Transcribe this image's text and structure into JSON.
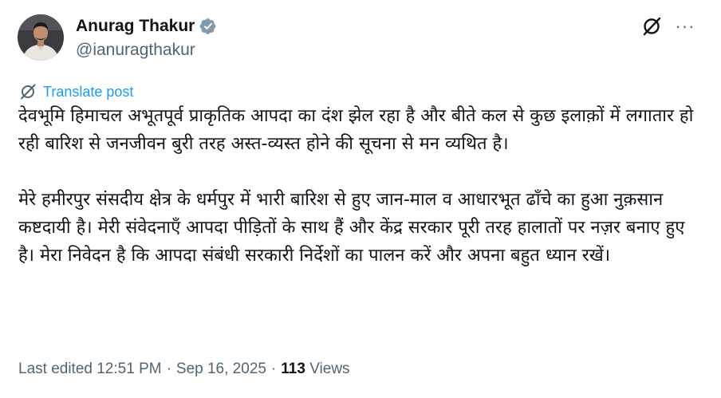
{
  "author": {
    "display_name": "Anurag Thakur",
    "handle": "@ianuragthakur",
    "verified": true
  },
  "actions": {
    "grok_icon": "grok-icon",
    "more_label": "···"
  },
  "translate": {
    "label": "Translate post"
  },
  "post": {
    "paragraphs": [
      "देवभूमि हिमाचल अभूतपूर्व प्राकृतिक आपदा का दंश झेल रहा है और बीते कल से कुछ इलाक़ों में लगातार हो रही बारिश से जनजीवन बुरी तरह अस्त-व्यस्त होने की सूचना से मन व्यथित है।",
      "मेरे हमीरपुर संसदीय क्षेत्र के धर्मपुर में भारी बारिश से हुए जान-माल व आधारभूत ढाँचे का हुआ नुक़सान कष्टदायी है। मेरी संवेदनाएँ आपदा पीड़ितों के साथ हैं और केंद्र सरकार पूरी तरह हालातों पर नज़र बनाए हुए है। मेरा निवेदन है कि आपदा संबंधी सरकारी निर्देशों का पालन करें और अपना बहुत ध्यान रखें।"
    ]
  },
  "meta": {
    "edited_label": "Last edited 12:51 PM",
    "date": "Sep 16, 2025",
    "separator": "·",
    "views_count": "113",
    "views_label": "Views"
  },
  "colors": {
    "text_primary": "#0f1419",
    "text_secondary": "#536471",
    "link_blue": "#1d9bf0"
  }
}
